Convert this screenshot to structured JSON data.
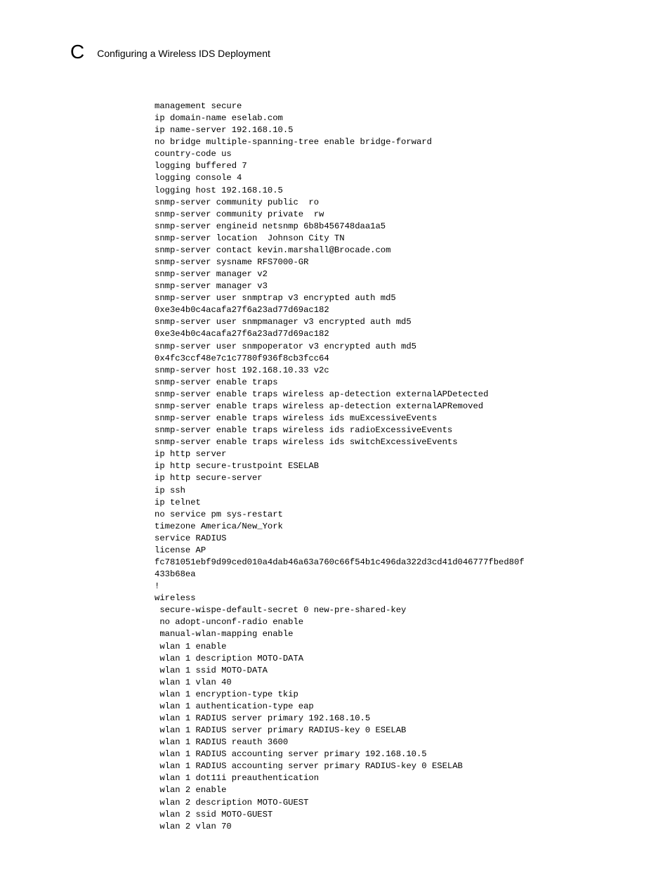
{
  "header": {
    "appendix_letter": "C",
    "title": "Configuring a Wireless IDS Deployment"
  },
  "config_lines": [
    "management secure",
    "ip domain-name eselab.com",
    "ip name-server 192.168.10.5",
    "no bridge multiple-spanning-tree enable bridge-forward",
    "country-code us",
    "logging buffered 7",
    "logging console 4",
    "logging host 192.168.10.5",
    "snmp-server community public  ro",
    "snmp-server community private  rw",
    "snmp-server engineid netsnmp 6b8b456748daa1a5",
    "snmp-server location  Johnson City TN",
    "snmp-server contact kevin.marshall@Brocade.com",
    "snmp-server sysname RFS7000-GR",
    "snmp-server manager v2",
    "snmp-server manager v3",
    "snmp-server user snmptrap v3 encrypted auth md5 0xe3e4b0c4acafa27f6a23ad77d69ac182",
    "snmp-server user snmpmanager v3 encrypted auth md5 0xe3e4b0c4acafa27f6a23ad77d69ac182",
    "snmp-server user snmpoperator v3 encrypted auth md5 0x4fc3ccf48e7c1c7780f936f8cb3fcc64",
    "snmp-server host 192.168.10.33 v2c",
    "snmp-server enable traps",
    "snmp-server enable traps wireless ap-detection externalAPDetected",
    "snmp-server enable traps wireless ap-detection externalAPRemoved",
    "snmp-server enable traps wireless ids muExcessiveEvents",
    "snmp-server enable traps wireless ids radioExcessiveEvents",
    "snmp-server enable traps wireless ids switchExcessiveEvents",
    "ip http server",
    "ip http secure-trustpoint ESELAB",
    "ip http secure-server",
    "ip ssh",
    "ip telnet",
    "no service pm sys-restart",
    "timezone America/New_York",
    "service RADIUS",
    "license AP fc781051ebf9d99ced010a4dab46a63a760c66f54b1c496da322d3cd41d046777fbed80f433b68ea",
    "!",
    "wireless",
    " secure-wispe-default-secret 0 new-pre-shared-key",
    " no adopt-unconf-radio enable",
    " manual-wlan-mapping enable",
    " wlan 1 enable",
    " wlan 1 description MOTO-DATA",
    " wlan 1 ssid MOTO-DATA",
    " wlan 1 vlan 40",
    " wlan 1 encryption-type tkip",
    " wlan 1 authentication-type eap",
    " wlan 1 RADIUS server primary 192.168.10.5",
    " wlan 1 RADIUS server primary RADIUS-key 0 ESELAB",
    " wlan 1 RADIUS reauth 3600",
    " wlan 1 RADIUS accounting server primary 192.168.10.5",
    " wlan 1 RADIUS accounting server primary RADIUS-key 0 ESELAB",
    " wlan 1 dot11i preauthentication",
    " wlan 2 enable",
    " wlan 2 description MOTO-GUEST",
    " wlan 2 ssid MOTO-GUEST",
    " wlan 2 vlan 70"
  ]
}
